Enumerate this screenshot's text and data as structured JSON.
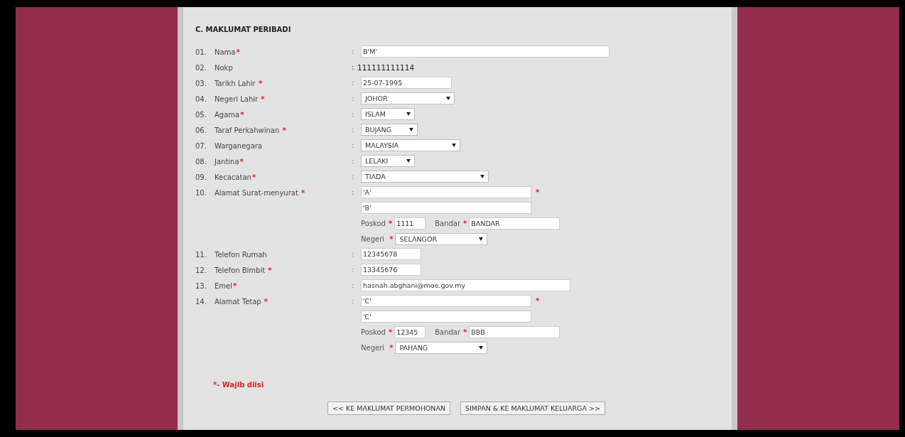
{
  "section": {
    "title": "C. MAKLUMAT PERIBADI"
  },
  "fields": [
    {
      "kind": "text",
      "number": "01.",
      "label": "Nama",
      "mark": "*",
      "separator": ":",
      "value": "B'M'"
    },
    {
      "kind": "static",
      "number": "02.",
      "label": "Nokp",
      "separator": ":",
      "value": "111111111114"
    },
    {
      "kind": "text",
      "number": "03.",
      "label": "Tarikh Lahir ",
      "mark": "*",
      "separator": ":",
      "value": "25-07-1995"
    },
    {
      "kind": "select",
      "number": "04.",
      "label": "Negeri Lahir ",
      "mark": "*",
      "separator": ":",
      "value": "JOHOR"
    },
    {
      "kind": "select",
      "number": "05.",
      "label": "Agama",
      "mark": "*",
      "separator": ":",
      "value": "ISLAM"
    },
    {
      "kind": "select",
      "number": "06.",
      "label": "Taraf Perkahwinan ",
      "mark": "*",
      "separator": ":",
      "value": "BUJANG"
    },
    {
      "kind": "select",
      "number": "07.",
      "label": "Warganegara",
      "separator": ":",
      "value": "MALAYSIA"
    },
    {
      "kind": "select",
      "number": "08.",
      "label": "Jantina",
      "mark": "*",
      "separator": ":",
      "value": "LELAKI"
    },
    {
      "kind": "select",
      "number": "09.",
      "label": "Kecacatan",
      "mark": "*",
      "separator": ":",
      "value": "TIADA"
    },
    {
      "kind": "address",
      "number": "10.",
      "label": "Alamat Surat-menyurat ",
      "mark": "*",
      "separator": ":",
      "lines": [
        "'A'",
        "'B'"
      ],
      "line_mark": "*",
      "postcode": {
        "label": "Poskod",
        "mark": "*",
        "value": "1111"
      },
      "city": {
        "label": "Bandar",
        "mark": "*",
        "value": "BANDAR"
      },
      "state": {
        "label": "Negeri ",
        "mark": "*",
        "value": "SELANGOR"
      }
    },
    {
      "kind": "text",
      "number": "11.",
      "label": "Telefon Rumah",
      "separator": ":",
      "value": "12345678"
    },
    {
      "kind": "text",
      "number": "12.",
      "label": "Telefon Bimbit ",
      "mark": "*",
      "separator": ":",
      "value": "13345676"
    },
    {
      "kind": "text",
      "number": "13.",
      "label": "Emel",
      "mark": "*",
      "separator": ":",
      "value": "hasnah.abghani@moe.gov.my"
    },
    {
      "kind": "address",
      "number": "14.",
      "label": "Alamat Tetap ",
      "mark": "*",
      "separator": ":",
      "lines": [
        "'C'",
        "'C'"
      ],
      "line_mark": "*",
      "postcode": {
        "label": "Poskod",
        "mark": "*",
        "value": "12345"
      },
      "city": {
        "label": "Bandar",
        "mark": "*",
        "value": "BBB"
      },
      "state": {
        "label": "Negeri ",
        "mark": "*",
        "value": "PAHANG"
      }
    }
  ],
  "note": "*- Wajib diisi",
  "buttons": [
    {
      "label": "<< KE MAKLUMAT PERMOHONAN"
    },
    {
      "label": "SIMPAN & KE MAKLUMAT KELUARGA >>"
    }
  ]
}
